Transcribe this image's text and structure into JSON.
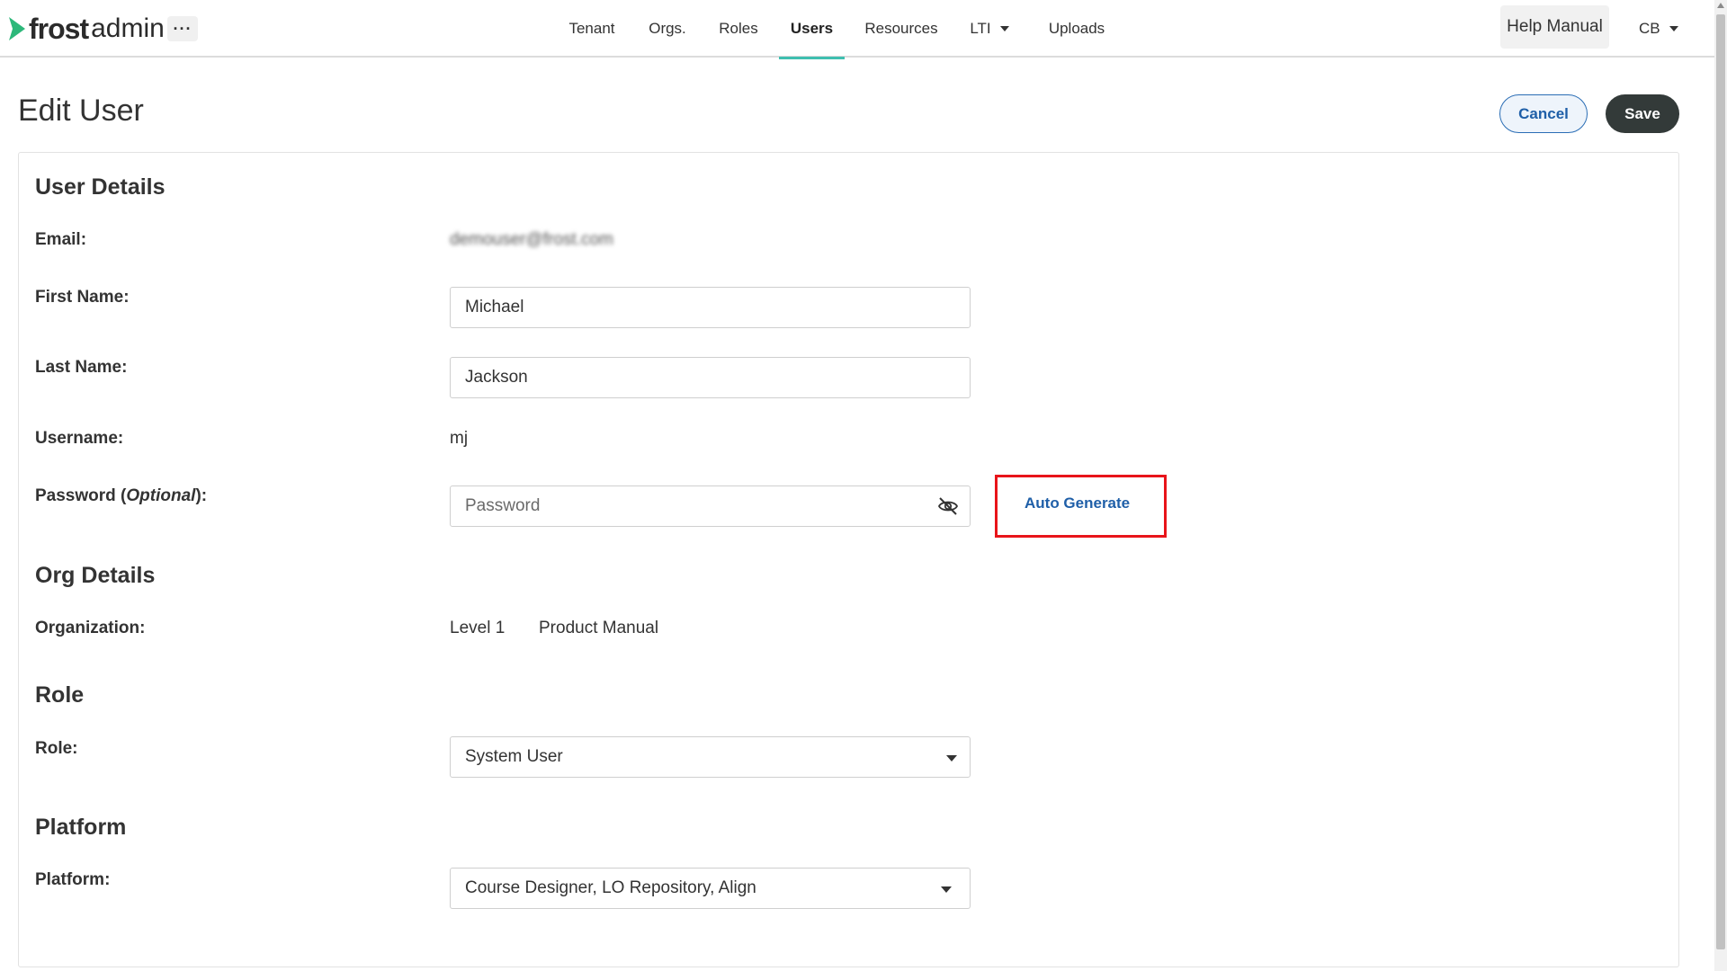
{
  "app": {
    "logo_brand": "frost",
    "logo_suffix": "admin",
    "more_label": "···"
  },
  "nav": {
    "items": [
      {
        "label": "Tenant"
      },
      {
        "label": "Orgs."
      },
      {
        "label": "Roles"
      },
      {
        "label": "Users",
        "active": true
      },
      {
        "label": "Resources"
      },
      {
        "label": "LTI",
        "dropdown": true
      },
      {
        "label": "Uploads"
      }
    ],
    "help_label": "Help Manual",
    "user_initials": "CB"
  },
  "page": {
    "title": "Edit User",
    "cancel_label": "Cancel",
    "save_label": "Save"
  },
  "user_details": {
    "section_title": "User Details",
    "email_label": "Email:",
    "email_value": "demouser@frost.com",
    "first_name_label": "First Name:",
    "first_name_value": "Michael",
    "last_name_label": "Last Name:",
    "last_name_value": "Jackson",
    "username_label": "Username:",
    "username_value": "mj",
    "password_label_prefix": "Password (",
    "password_label_optional": "Optional",
    "password_label_suffix": "):",
    "password_placeholder": "Password",
    "auto_generate_label": "Auto Generate"
  },
  "org_details": {
    "section_title": "Org Details",
    "organization_label": "Organization:",
    "level": "Level 1",
    "org_name": "Product Manual"
  },
  "role": {
    "section_title": "Role",
    "role_label": "Role:",
    "role_value": "System User"
  },
  "platform": {
    "section_title": "Platform",
    "platform_label": "Platform:",
    "platform_value": "Course Designer, LO Repository, Align"
  },
  "colors": {
    "accent_teal": "#3fbfb0",
    "link_blue": "#1f5fa8",
    "save_dark": "#333a39",
    "highlight_red": "#e8141a",
    "logo_green": "#2db87a"
  }
}
